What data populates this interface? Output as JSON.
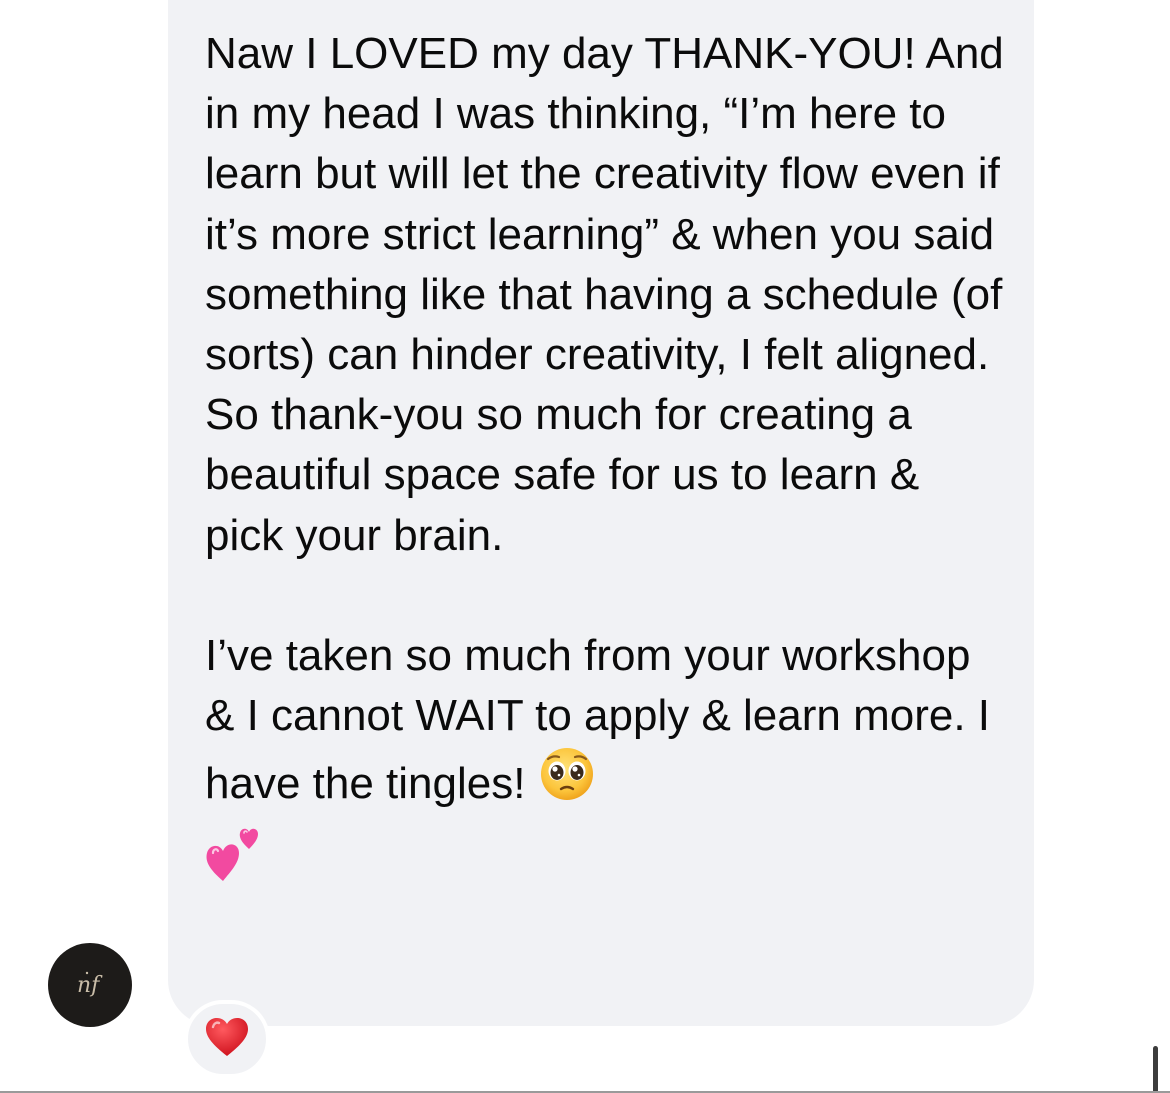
{
  "message": {
    "paragraph_1": "Naw I LOVED my day THANK-YOU! And in my head I was thinking, “I’m here to learn but will let the creativity flow even if it’s more strict learning” & when you said something like that having a schedule (of sorts) can hinder creativity, I felt aligned. So thank-you so much for creating a beautiful space safe for us to learn & pick your brain.",
    "paragraph_2": "I’ve taken so much from your workshop & I cannot WAIT to apply & learn more. I have the tingles!"
  },
  "avatar": {
    "monogram": "nf",
    "icon": "nf-monogram-logo"
  },
  "reaction": {
    "icon": "red-heart-icon"
  },
  "icons": {
    "emoji_1": "pleading-face-emoji",
    "emoji_2": "two-hearts-emoji"
  },
  "colors": {
    "bubble": "#f1f2f5",
    "avatar_bg": "#1d1b19",
    "text": "#0b0b0b",
    "heart": "#e0252e",
    "pink_heart": "#f24aa0"
  }
}
